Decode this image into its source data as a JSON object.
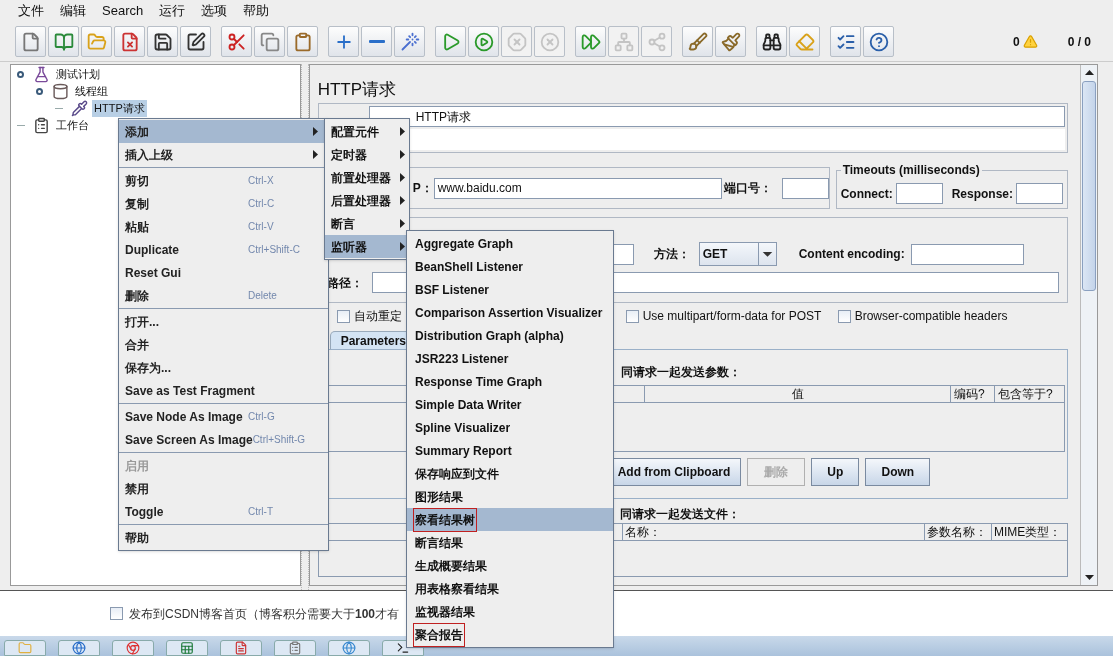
{
  "menubar": [
    "文件",
    "编辑",
    "Search",
    "运行",
    "选项",
    "帮助"
  ],
  "toolbar": {
    "groups": [
      [
        {
          "kind": "new",
          "disabled": false
        },
        {
          "kind": "templates",
          "disabled": false
        },
        {
          "kind": "open",
          "disabled": false
        },
        {
          "kind": "close",
          "disabled": false
        },
        {
          "kind": "save",
          "disabled": false
        },
        {
          "kind": "save_image",
          "disabled": false
        }
      ],
      [
        {
          "kind": "cut",
          "disabled": false
        },
        {
          "kind": "copy",
          "disabled": false
        },
        {
          "kind": "paste",
          "disabled": false
        }
      ],
      [
        {
          "kind": "expand",
          "disabled": false
        },
        {
          "kind": "collapse",
          "disabled": false
        },
        {
          "kind": "toggle",
          "disabled": false
        }
      ],
      [
        {
          "kind": "start",
          "disabled": false
        },
        {
          "kind": "start_no_timers",
          "disabled": false
        },
        {
          "kind": "stop",
          "disabled": true
        },
        {
          "kind": "shutdown",
          "disabled": true
        }
      ],
      [
        {
          "kind": "remote_start",
          "disabled": false
        },
        {
          "kind": "remote_stop",
          "disabled": true
        },
        {
          "kind": "remote_shutdown",
          "disabled": true
        }
      ],
      [
        {
          "kind": "clear",
          "disabled": false
        },
        {
          "kind": "clear_all",
          "disabled": false
        }
      ],
      [
        {
          "kind": "search",
          "disabled": false
        },
        {
          "kind": "reset_search",
          "disabled": false
        }
      ],
      [
        {
          "kind": "functions",
          "disabled": false
        },
        {
          "kind": "help",
          "disabled": false
        }
      ]
    ],
    "warnings": "0",
    "threads": "0 / 0"
  },
  "tree": {
    "items": [
      {
        "label": "测试计划",
        "kind": "plan",
        "expanded": true,
        "selected": false,
        "children": [
          {
            "label": "线程组",
            "kind": "threads",
            "expanded": true,
            "selected": false,
            "children": [
              {
                "label": "HTTP请求",
                "kind": "sampler",
                "selected": true
              }
            ]
          }
        ]
      },
      {
        "label": "工作台",
        "kind": "workbench",
        "selected": false
      }
    ]
  },
  "editor": {
    "title": "HTTP请求",
    "name_value": "HTTP请求",
    "server": {
      "label": "P：",
      "host": "www.baidu.com",
      "port_label": "端口号："
    },
    "timeouts": {
      "title": "Timeouts (milliseconds)",
      "connect_label": "Connect:",
      "response_label": "Response:"
    },
    "request": {
      "method_label": "方法：",
      "method": "GET",
      "encoding_label": "Content encoding:",
      "path_label": "路径：",
      "options": [
        {
          "label": "自动重定",
          "checked": false
        },
        {
          "label": "Use multipart/form-data for POST",
          "checked": false
        },
        {
          "label": "Browser-compatible headers",
          "checked": false
        }
      ]
    },
    "tabs": [
      {
        "label": "Parameters",
        "selected": true
      }
    ],
    "parameters": {
      "title": "同请求一起发送参数：",
      "columns": [
        "值",
        "编码?",
        "包含等于?"
      ],
      "buttons": [
        {
          "label": "Add from Clipboard",
          "disabled": false
        },
        {
          "label": "删除",
          "disabled": true
        },
        {
          "label": "Up",
          "disabled": false
        },
        {
          "label": "Down",
          "disabled": false
        }
      ]
    },
    "files": {
      "title": "同请求一起发送文件：",
      "columns": [
        "名称：",
        "参数名称：",
        "MIME类型："
      ]
    }
  },
  "context_menu": {
    "items": [
      {
        "kind": "submenu",
        "label": "添加",
        "selected": true,
        "disabled": false
      },
      {
        "kind": "submenu",
        "label": "插入上级",
        "selected": false,
        "disabled": false
      },
      {
        "kind": "separator"
      },
      {
        "kind": "item",
        "label": "剪切",
        "shortcut": "Ctrl-X",
        "selected": false,
        "disabled": false
      },
      {
        "kind": "item",
        "label": "复制",
        "shortcut": "Ctrl-C",
        "selected": false,
        "disabled": false
      },
      {
        "kind": "item",
        "label": "粘贴",
        "shortcut": "Ctrl-V",
        "selected": false,
        "disabled": false
      },
      {
        "kind": "item",
        "label": "Duplicate",
        "shortcut": "Ctrl+Shift-C",
        "selected": false,
        "disabled": false
      },
      {
        "kind": "item",
        "label": "Reset Gui",
        "selected": false,
        "disabled": false
      },
      {
        "kind": "item",
        "label": "删除",
        "shortcut": "Delete",
        "selected": false,
        "disabled": false
      },
      {
        "kind": "separator"
      },
      {
        "kind": "item",
        "label": "打开...",
        "selected": false,
        "disabled": false
      },
      {
        "kind": "item",
        "label": "合并",
        "selected": false,
        "disabled": false
      },
      {
        "kind": "item",
        "label": "保存为...",
        "selected": false,
        "disabled": false
      },
      {
        "kind": "item",
        "label": "Save as Test Fragment",
        "selected": false,
        "disabled": false
      },
      {
        "kind": "separator"
      },
      {
        "kind": "item",
        "label": "Save Node As Image",
        "shortcut": "Ctrl-G",
        "selected": false,
        "disabled": false
      },
      {
        "kind": "item",
        "label": "Save Screen As Image",
        "shortcut": "Ctrl+Shift-G",
        "selected": false,
        "disabled": false
      },
      {
        "kind": "separator"
      },
      {
        "kind": "item",
        "label": "启用",
        "selected": false,
        "disabled": true
      },
      {
        "kind": "item",
        "label": "禁用",
        "selected": false,
        "disabled": false
      },
      {
        "kind": "item",
        "label": "Toggle",
        "shortcut": "Ctrl-T",
        "selected": false,
        "disabled": false
      },
      {
        "kind": "separator"
      },
      {
        "kind": "item",
        "label": "帮助",
        "selected": false,
        "disabled": false
      }
    ]
  },
  "add_menu": {
    "items": [
      {
        "label": "配置元件",
        "selected": false
      },
      {
        "label": "定时器",
        "selected": false
      },
      {
        "label": "前置处理器",
        "selected": false
      },
      {
        "label": "后置处理器",
        "selected": false
      },
      {
        "label": "断言",
        "selected": false
      },
      {
        "label": "监听器",
        "selected": true
      }
    ]
  },
  "listener_menu": {
    "items": [
      {
        "label": "Aggregate Graph",
        "selected": false,
        "marked": false
      },
      {
        "label": "BeanShell Listener",
        "selected": false,
        "marked": false
      },
      {
        "label": "BSF Listener",
        "selected": false,
        "marked": false
      },
      {
        "label": "Comparison Assertion Visualizer",
        "selected": false,
        "marked": false
      },
      {
        "label": "Distribution Graph (alpha)",
        "selected": false,
        "marked": false
      },
      {
        "label": "JSR223 Listener",
        "selected": false,
        "marked": false
      },
      {
        "label": "Response Time Graph",
        "selected": false,
        "marked": false
      },
      {
        "label": "Simple Data Writer",
        "selected": false,
        "marked": false
      },
      {
        "label": "Spline Visualizer",
        "selected": false,
        "marked": false
      },
      {
        "label": "Summary Report",
        "selected": false,
        "marked": false
      },
      {
        "label": "保存响应到文件",
        "selected": false,
        "marked": false
      },
      {
        "label": "图形结果",
        "selected": false,
        "marked": false
      },
      {
        "label": "察看结果树",
        "selected": true,
        "marked": true
      },
      {
        "label": "断言结果",
        "selected": false,
        "marked": false
      },
      {
        "label": "生成概要结果",
        "selected": false,
        "marked": false
      },
      {
        "label": "用表格察看结果",
        "selected": false,
        "marked": false
      },
      {
        "label": "监视器结果",
        "selected": false,
        "marked": false
      },
      {
        "label": "聚合报告",
        "selected": false,
        "marked": true
      }
    ]
  },
  "background_page": {
    "checkbox": {
      "label": "发布到CSDN博客首页（博客积分需要大于**100**才有",
      "checked": false
    }
  }
}
